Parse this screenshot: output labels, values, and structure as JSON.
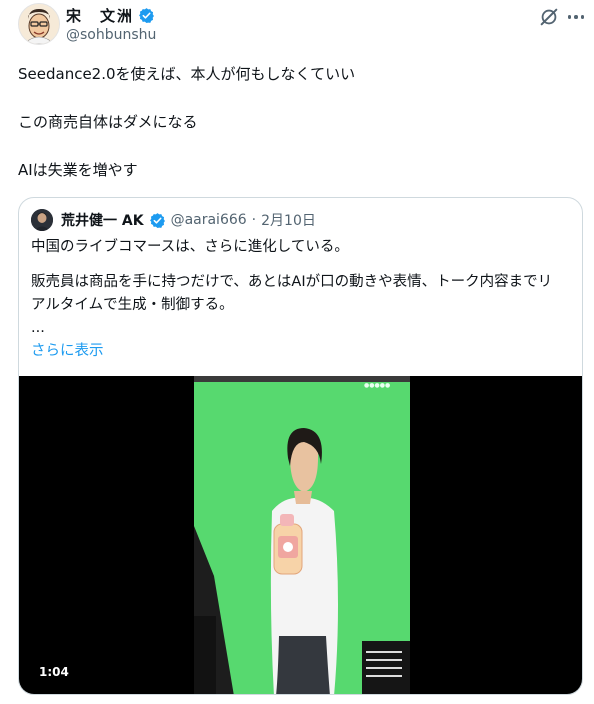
{
  "post": {
    "author_name": "宋　文洲",
    "author_handle": "@sohbunshu",
    "lines": [
      "Seedance2.0を使えば、本人が何もしなくていい",
      "この商売自体はダメになる",
      "AIは失業を増やす"
    ]
  },
  "quote": {
    "author_name": "荒井健一 AK",
    "author_handle": "@aarai666",
    "separator": "·",
    "date": "2月10日",
    "line1": "中国のライブコマースは、さらに進化している。",
    "line2": "販売員は商品を手に持つだけで、あとはAIが口の動きや表情、トーク内容までリ",
    "line3": "アルタイムで生成・制御する。",
    "ellipsis": "...",
    "show_more": "さらに表示",
    "video": {
      "duration": "1:04"
    }
  },
  "colors": {
    "link": "#1d9bf0",
    "verified": "#1d9bf0",
    "secondary_text": "#536471",
    "green_screen": "#4fd86a"
  },
  "icons": [
    "verified-badge-icon",
    "grok-icon",
    "more-options-icon"
  ]
}
